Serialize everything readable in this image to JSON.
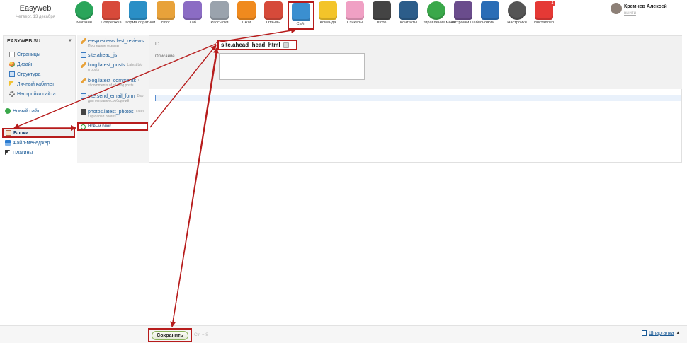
{
  "brand": {
    "name": "Easyweb",
    "date": "Четверг, 13 декабря"
  },
  "apps": [
    {
      "id": "shop",
      "label": "Магазин",
      "icon": "dollar-icon",
      "color": "#2aa55a"
    },
    {
      "id": "support",
      "label": "Поддержка",
      "icon": "lifebuoy-icon",
      "color": "#d84a3a"
    },
    {
      "id": "feedback",
      "label": "Форма обратной",
      "icon": "form-icon",
      "color": "#2a8fc6"
    },
    {
      "id": "blog",
      "label": "Блог",
      "icon": "pencil-icon",
      "color": "#e8a23a"
    },
    {
      "id": "hub",
      "label": "Хаб",
      "icon": "hub-icon",
      "color": "#8b6cc4"
    },
    {
      "id": "mailer",
      "label": "Рассылки",
      "icon": "mailer-icon",
      "color": "#9aa3ad"
    },
    {
      "id": "crm",
      "label": "CRM",
      "icon": "crm-icon",
      "color": "#f08a1e"
    },
    {
      "id": "reviews",
      "label": "Отзывы",
      "icon": "speech-icon",
      "color": "#d64a3a"
    },
    {
      "id": "site",
      "label": "Сайт",
      "icon": "site-icon",
      "color": "#3b8fd0",
      "active": true
    },
    {
      "id": "team",
      "label": "Команда",
      "icon": "team-icon",
      "color": "#f3c42a"
    },
    {
      "id": "stickers",
      "label": "Стикеры",
      "icon": "stickers-icon",
      "color": "#f0a0c4"
    },
    {
      "id": "photo",
      "label": "Фото",
      "icon": "camera-icon",
      "color": "#444444"
    },
    {
      "id": "contacts",
      "label": "Контакты",
      "icon": "contacts-icon",
      "color": "#2c5d8a"
    },
    {
      "id": "menu",
      "label": "Управление меню",
      "icon": "menu-icon",
      "color": "#3aa84a"
    },
    {
      "id": "templates",
      "label": "Настройки шаблонов",
      "icon": "templates-icon",
      "color": "#6a4c8c"
    },
    {
      "id": "logs",
      "label": "Логи",
      "icon": "asterisk-icon",
      "color": "#2a6db6"
    },
    {
      "id": "settings",
      "label": "Настройки",
      "icon": "gear-icon",
      "color": "#555555"
    },
    {
      "id": "installer",
      "label": "Инсталлер",
      "icon": "installer-icon",
      "color": "#e53935",
      "badge": "4"
    }
  ],
  "user": {
    "name": "Кремнев Алексей",
    "exit": "выйти"
  },
  "sidebar": {
    "site_title": "EASYWEB.SU",
    "site_items": [
      {
        "label": "Страницы",
        "icon": "pages-icon"
      },
      {
        "label": "Дизайн",
        "icon": "palette-icon"
      },
      {
        "label": "Структура",
        "icon": "structure-icon"
      },
      {
        "label": "Личный кабинет",
        "icon": "key-icon"
      },
      {
        "label": "Настройки сайта",
        "icon": "gear-icon"
      }
    ],
    "new_site": "Новый сайт",
    "nav": [
      {
        "label": "Блоки",
        "icon": "blocks-icon"
      },
      {
        "label": "Файл-менеджер",
        "icon": "download-icon"
      },
      {
        "label": "Плагины",
        "icon": "plugin-icon"
      }
    ]
  },
  "blocks": [
    {
      "name": "easyreviews.last_reviews",
      "tag": "",
      "desc": "Последние отзывы",
      "icon": "pencil-icon"
    },
    {
      "name": "site.ahead_js",
      "tag": "",
      "desc": "",
      "icon": "page-icon"
    },
    {
      "name": "blog.latest_posts",
      "tag": "Latest blo",
      "desc": "g posts",
      "icon": "pencil-icon"
    },
    {
      "name": "blog.latest_comments",
      "tag": "L",
      "desc": "st comments of all blog posts",
      "icon": "pencil-icon"
    },
    {
      "name": "site.send_email_form",
      "tag": "Бар",
      "desc": "для отправки сообщений",
      "icon": "page-icon"
    },
    {
      "name": "photos.latest_photos",
      "tag": "Lates",
      "desc": "t uploaded photos",
      "icon": "camera-icon"
    }
  ],
  "new_block": "Новый блок",
  "editor": {
    "id_label": "ID",
    "id_value": "site.ahead_head_html",
    "desc_label": "Описание",
    "desc_value": ""
  },
  "footer": {
    "save": "Сохранить",
    "save_hint": "Ctrl + S",
    "cheatsheet": "Шпаргалка"
  },
  "colors": {
    "annotation": "#b71c1c",
    "link": "#1a5a96",
    "panel": "#f3f3f3"
  }
}
